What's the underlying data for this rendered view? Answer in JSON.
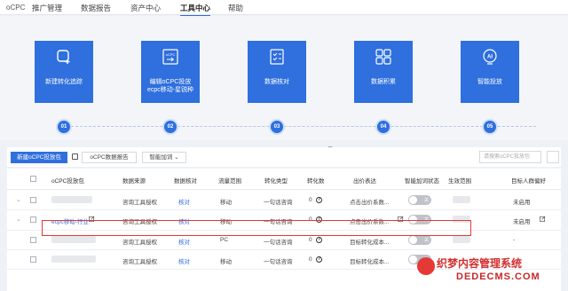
{
  "nav": {
    "brand": "oCPC",
    "items": [
      "推广管理",
      "数据报告",
      "资产中心",
      "工具中心",
      "帮助"
    ],
    "active": "工具中心"
  },
  "steps": [
    {
      "label_lines": [
        "新建转化追踪"
      ],
      "num": "01",
      "icon": "add-tracking-icon"
    },
    {
      "label_lines": [
        "编辑oCPC投放",
        "ecpc移动-星锐种"
      ],
      "num": "02",
      "icon": "ocpc-edit-icon"
    },
    {
      "label_lines": [
        "数据核对"
      ],
      "num": "03",
      "icon": "checklist-icon"
    },
    {
      "label_lines": [
        "数据积累"
      ],
      "num": "04",
      "icon": "grid-icon"
    },
    {
      "label_lines": [
        "智能投放"
      ],
      "num": "05",
      "icon": "ai-icon"
    }
  ],
  "toolbar": {
    "new_package": "新建oCPC投放包",
    "report": "oCPC数据报告",
    "smart_add": "智能加词",
    "search_placeholder": "请搜索oCPC投放包"
  },
  "table": {
    "headers": [
      "oCPC投放包",
      "数据来源",
      "数据核对",
      "流量范围",
      "转化类型",
      "转化数",
      "出价表达",
      "智能加词状态",
      "生效范围",
      "目标人群偏好"
    ],
    "rows": [
      {
        "name": "",
        "source": "咨询工具授权",
        "check": "核对",
        "scope": "移动",
        "type": "一句话咨询",
        "count": "0",
        "bid": "点击出价系数...",
        "toggle": "关",
        "pref": "未启用"
      },
      {
        "name": "ecpc移动-行业",
        "source": "咨询工具授权",
        "check": "核对",
        "scope": "移动",
        "type": "一句话咨询",
        "count": "0",
        "bid": "点击出价系数...",
        "toggle": "关",
        "pref": "未启用"
      },
      {
        "name": "",
        "source": "咨询工具授权",
        "check": "核对",
        "scope": "PC",
        "type": "一句话咨询",
        "count": "0",
        "bid": "目标转化成本...",
        "toggle": "关",
        "pref": "-"
      },
      {
        "name": "",
        "source": "咨询工具授权",
        "check": "核对",
        "scope": "移动",
        "type": "一句话咨询",
        "count": "0",
        "bid": "目标转化成本...",
        "toggle": "关",
        "pref": ""
      }
    ]
  },
  "watermark": {
    "line1": "织梦内容管理系统",
    "line2": "DEDECMS.COM"
  },
  "colors": {
    "accent": "#2f6fde",
    "highlight": "#e53935"
  }
}
